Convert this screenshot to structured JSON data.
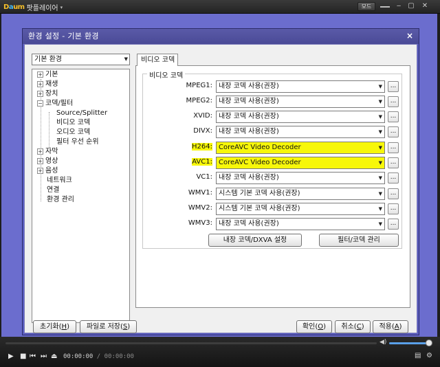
{
  "player": {
    "name": "팟플레이어",
    "menu_arrow": "▾",
    "mode_label": "모드",
    "current_time": "00:00:00",
    "time_separator": "/",
    "total_time": "00:00:00"
  },
  "dialog": {
    "title": "환경 설정 - 기본 환경",
    "close": "×",
    "left_combo": "기본 환경",
    "tree": [
      {
        "label": "기본",
        "toggle": "+",
        "level": 0
      },
      {
        "label": "재생",
        "toggle": "+",
        "level": 0
      },
      {
        "label": "장치",
        "toggle": "+",
        "level": 0
      },
      {
        "label": "코덱/필터",
        "toggle": "−",
        "level": 0
      },
      {
        "label": "Source/Splitter",
        "toggle": "",
        "level": 1
      },
      {
        "label": "비디오 코덱",
        "toggle": "",
        "level": 1
      },
      {
        "label": "오디오 코덱",
        "toggle": "",
        "level": 1
      },
      {
        "label": "필터 우선 순위",
        "toggle": "",
        "level": 1
      },
      {
        "label": "자막",
        "toggle": "+",
        "level": 0
      },
      {
        "label": "영상",
        "toggle": "+",
        "level": 0
      },
      {
        "label": "음성",
        "toggle": "+",
        "level": 0
      },
      {
        "label": "네트워크",
        "toggle": "",
        "level": 0
      },
      {
        "label": "연결",
        "toggle": "",
        "level": 0
      },
      {
        "label": "환경 관리",
        "toggle": "",
        "level": 0
      }
    ],
    "tab_label": "비디오 코덱",
    "group_title": "비디오 코덱",
    "codecs": [
      {
        "label": "MPEG1:",
        "value": "내장 코덱 사용(권장)",
        "highlight": false
      },
      {
        "label": "MPEG2:",
        "value": "내장 코덱 사용(권장)",
        "highlight": false
      },
      {
        "label": "XVID:",
        "value": "내장 코덱 사용(권장)",
        "highlight": false
      },
      {
        "label": "DIVX:",
        "value": "내장 코덱 사용(권장)",
        "highlight": false
      },
      {
        "label": "H264:",
        "value": "CoreAVC Video Decoder",
        "highlight": true
      },
      {
        "label": "AVC1:",
        "value": "CoreAVC Video Decoder",
        "highlight": true
      },
      {
        "label": "VC1:",
        "value": "내장 코덱 사용(권장)",
        "highlight": false
      },
      {
        "label": "WMV1:",
        "value": "시스템 기본 코덱 사용(권장)",
        "highlight": false
      },
      {
        "label": "WMV2:",
        "value": "시스템 기본 코덱 사용(권장)",
        "highlight": false
      },
      {
        "label": "WMV3:",
        "value": "내장 코덱 사용(권장)",
        "highlight": false
      }
    ],
    "ellipsis": "...",
    "dxva_button": "내장 코덱/DXVA 설정",
    "filter_button": "필터/코덱 관리",
    "bottom_buttons": {
      "reset": {
        "text": "초기화(",
        "key": "H",
        "end": ")"
      },
      "save_file": {
        "text": "파일로 저장(",
        "key": "S",
        "end": ")"
      },
      "ok": {
        "text": "확인(",
        "key": "O",
        "end": ")"
      },
      "cancel": {
        "text": "취소(",
        "key": "C",
        "end": ")"
      },
      "apply": {
        "text": "적용(",
        "key": "A",
        "end": ")"
      }
    }
  },
  "colors": {
    "backdrop": "#6b6dce",
    "highlight": "#f7f70a",
    "volume": "#5aa0e8"
  }
}
